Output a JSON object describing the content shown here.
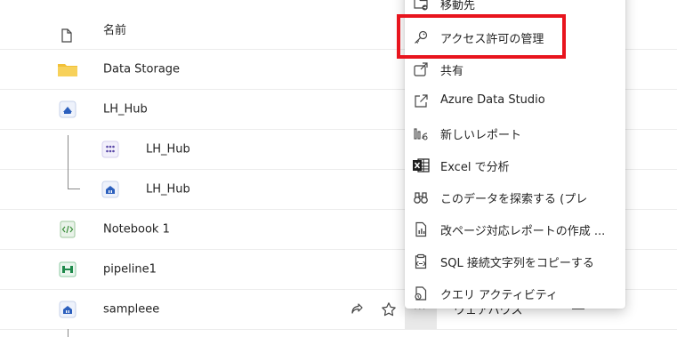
{
  "list": {
    "header": {
      "name_label": "名前"
    },
    "rows": [
      {
        "label": "Data Storage",
        "icon": "folder-icon"
      },
      {
        "label": "LH_Hub",
        "icon": "lakehouse-icon"
      },
      {
        "label": "LH_Hub",
        "icon": "semantic-model-icon"
      },
      {
        "label": "LH_Hub",
        "icon": "sql-endpoint-icon"
      },
      {
        "label": "Notebook 1",
        "icon": "notebook-icon"
      },
      {
        "label": "pipeline1",
        "icon": "pipeline-icon"
      },
      {
        "label": "sampleee",
        "icon": "warehouse-icon"
      }
    ],
    "selected_row_type": "ウェアハウス",
    "more_button": "···"
  },
  "context_menu": {
    "items": [
      {
        "label": "移動先",
        "icon": "move-to-icon"
      },
      {
        "label": "アクセス許可の管理",
        "icon": "key-icon",
        "highlighted": true
      },
      {
        "label": "共有",
        "icon": "share-icon"
      },
      {
        "label": "Azure Data Studio",
        "icon": "open-external-icon"
      },
      {
        "label": "新しいレポート",
        "icon": "report-icon"
      },
      {
        "label": "Excel で分析",
        "icon": "excel-icon"
      },
      {
        "label": "このデータを探索する (プレ",
        "icon": "binoculars-icon"
      },
      {
        "label": "改ページ対応レポートの作成 ...",
        "icon": "paginated-report-icon"
      },
      {
        "label": "SQL 接続文字列をコピーする",
        "icon": "clipboard-link-icon"
      },
      {
        "label": "クエリ アクティビティ",
        "icon": "query-activity-icon"
      }
    ]
  },
  "colors": {
    "highlight": "#e8141d",
    "folder": "#f2c037",
    "accent_blue": "#2b5fbd",
    "notebook_green": "#3b8f3b",
    "excel_green": "#1f1f1f"
  }
}
